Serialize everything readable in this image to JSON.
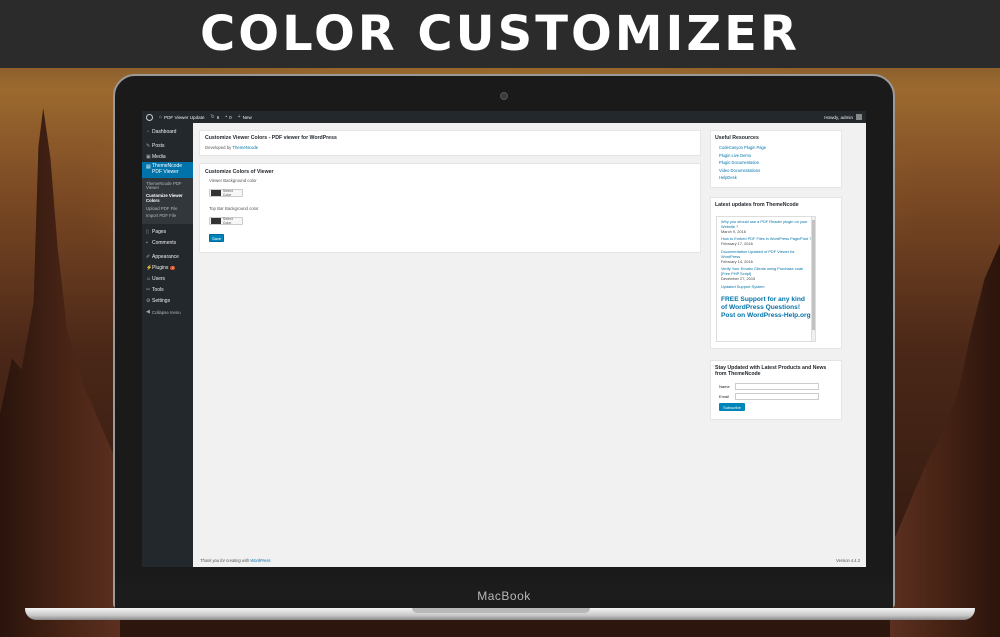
{
  "banner": {
    "title": "COLOR CUSTOMIZER"
  },
  "device": {
    "brand": "MacBook"
  },
  "adminbar": {
    "site_name": "PDF Viewer Update",
    "updates_count": "6",
    "comments_count": "0",
    "new_label": "New",
    "howdy": "Howdy, admin"
  },
  "sidebar": {
    "items": [
      {
        "label": "Dashboard",
        "icon": "dashboard-icon"
      },
      {
        "label": "Posts",
        "icon": "pin-icon"
      },
      {
        "label": "Media",
        "icon": "media-icon"
      },
      {
        "label": "ThemeNcode PDF Viewer",
        "icon": "pdf-icon"
      },
      {
        "label": "Pages",
        "icon": "page-icon"
      },
      {
        "label": "Comments",
        "icon": "comment-icon"
      },
      {
        "label": "Appearance",
        "icon": "brush-icon"
      },
      {
        "label": "Plugins",
        "icon": "plugin-icon",
        "badge": "2"
      },
      {
        "label": "Users",
        "icon": "user-icon"
      },
      {
        "label": "Tools",
        "icon": "wrench-icon"
      },
      {
        "label": "Settings",
        "icon": "settings-icon"
      },
      {
        "label": "Collapse menu",
        "icon": "collapse-icon"
      }
    ],
    "submenu": [
      "ThemeNcode PDF Viewer",
      "Customize Viewer Colors",
      "Upload PDF File",
      "Import PDF File"
    ]
  },
  "main": {
    "header_card": {
      "title": "Customize Viewer Colors - PDF viewer for WordPress",
      "developed_by": "Developed by",
      "developer": "ThemeNcode"
    },
    "colors_card": {
      "title": "Customize Colors of Viewer",
      "viewer_bg_label": "Viewer Background color",
      "topbar_bg_label": "Top Bar Background color",
      "select_color": "Select Color",
      "save": "Save"
    }
  },
  "resources": {
    "title": "Useful Resources",
    "links": [
      "CodeCanyon Plugin Page",
      "Plugin Live Demo",
      "Plugin Documentation",
      "Video Documentations",
      "HelpDesk"
    ]
  },
  "updates": {
    "title": "Latest updates from ThemeNcode",
    "items": [
      {
        "title": "Why you should use a PDF Reader plugin on your Website ?",
        "date": "March 9, 2016"
      },
      {
        "title": "How to Embed PDF Files in WordPress Page/Post ?",
        "date": "February 17, 2016"
      },
      {
        "title": "Documentation Updated of PDF Viewer for WordPress",
        "date": "February 14, 2016"
      },
      {
        "title": "Verify Your Envato Clients using Purchase code [Free PHP Script]",
        "date": "December 27, 2015"
      },
      {
        "title": "Updated Support System",
        "date": ""
      }
    ],
    "free_support": "FREE Support for any kind of WordPress Questions! Post on WordPress-Help.org"
  },
  "newsletter": {
    "title": "Stay Updated with Latest Products and News from ThemeNcode",
    "name_label": "Name",
    "email_label": "Email",
    "subscribe": "Subscribe"
  },
  "footer": {
    "thanks": "Thank you for creating with",
    "wp_link": "WordPress",
    "version": "Version 4.4.2"
  },
  "colors": {
    "accent": "#0073aa",
    "adminbar": "#23282d",
    "button": "#0085ba",
    "banner": "#2b2b2b"
  }
}
